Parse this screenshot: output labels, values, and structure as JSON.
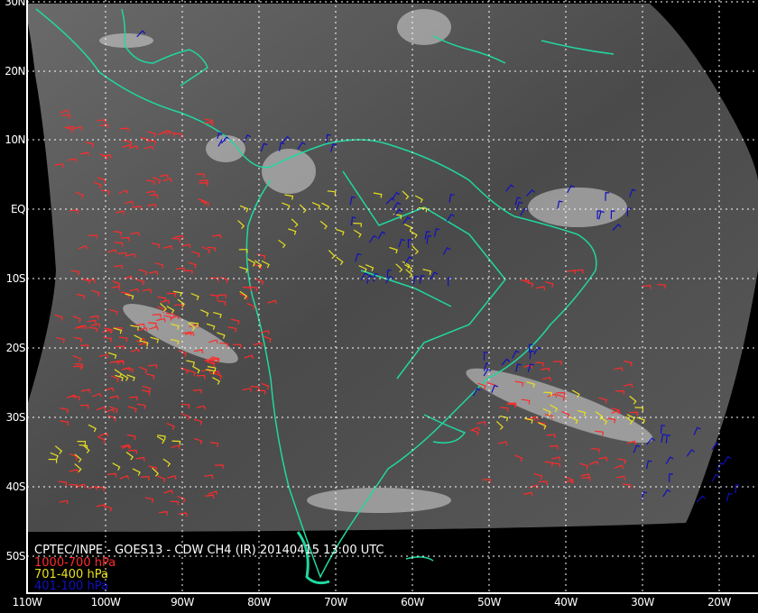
{
  "title": "CPTEC/INPE - GOES13 - CDW CH4 (IR) 20140415 13:00 UTC",
  "legend": [
    {
      "label": "1000-700 hPa",
      "color": "#ff2a2a"
    },
    {
      "label": "701-400 hPa",
      "color": "#e8e020"
    },
    {
      "label": "401-100 hPa",
      "color": "#1010c0"
    }
  ],
  "lat_labels": [
    "30N",
    "20N",
    "10N",
    "EQ",
    "10S",
    "20S",
    "30S",
    "40S",
    "50S"
  ],
  "lon_labels": [
    "110W",
    "100W",
    "90W",
    "80W",
    "70W",
    "60W",
    "50W",
    "40W",
    "30W",
    "20W"
  ],
  "colors": {
    "coast": "#20d8a0",
    "grid": "#ffffff",
    "background": "#000000"
  }
}
